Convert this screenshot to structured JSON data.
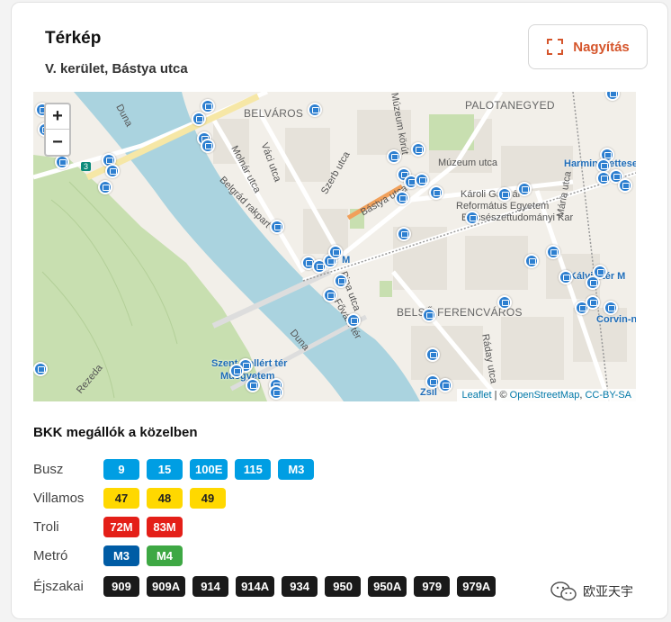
{
  "header": {
    "title": "Térkép",
    "subtitle": "V. kerület, Bástya utca",
    "zoom_button": "Nagyítás"
  },
  "map": {
    "labels": {
      "belvaros": "BELVÁROS",
      "palotanegyed": "PALOTANEGYED",
      "belso_ferencvaros": "BELSŐ FERENCVÁROS",
      "duna1": "Duna",
      "duna2": "Duna",
      "molnar": "Molnár utca",
      "vaci": "Váci utca",
      "belgrad": "Belgrád rakpart",
      "szerb": "Szerb utca",
      "bastya": "Bástya utca",
      "muzeum": "Múzeum utca",
      "karoli": "Károli Gáspár",
      "reformatus": "Református Egyetem",
      "bolcsesz": "Bölcsészettudományi Kar",
      "pipa": "Pipa utca",
      "fovam": "Fővám tér",
      "radai": "Ráday utca",
      "mana": "Mária utca",
      "kalvin": "Kálvin tér M",
      "harminckettesek": "Harminckettesek",
      "corvin": "Corvin-negyed M",
      "szent_gellert": "Szent Gellért tér",
      "muegyetem": "Műegyetem",
      "rezeda": "Rezeda",
      "zsil": "Zsil",
      "ter_m": "tér M",
      "muzeum_korut": "Múzeum körút",
      "dt": "3"
    },
    "zoom_in": "+",
    "zoom_out": "−",
    "attribution": {
      "leaflet": "Leaflet",
      "sep": "| ©",
      "osm": "OpenStreetMap",
      "comma": ",",
      "license": "CC-BY-SA"
    }
  },
  "stops": {
    "title": "BKK megállók a közelben",
    "rows": [
      {
        "label": "Busz",
        "kind": "bus",
        "lines": [
          "9",
          "15",
          "100E",
          "115",
          "M3"
        ]
      },
      {
        "label": "Villamos",
        "kind": "tram",
        "lines": [
          "47",
          "48",
          "49"
        ]
      },
      {
        "label": "Troli",
        "kind": "troli",
        "lines": [
          "72M",
          "83M"
        ]
      },
      {
        "label": "Metró",
        "kind": "metro",
        "lines": [
          "M3",
          "M4"
        ]
      },
      {
        "label": "Éjszakai",
        "kind": "night",
        "lines": [
          "909",
          "909A",
          "914",
          "914A",
          "934",
          "950",
          "950A",
          "979",
          "979A"
        ]
      }
    ]
  },
  "watermark": {
    "text": "欧亚天宇",
    "icon": "wechat-icon"
  },
  "colors": {
    "accent": "#d5552b",
    "bus": "#009ee3",
    "tram": "#ffd800",
    "troli": "#e41f18",
    "metro_m3": "#005ca5",
    "metro_m4": "#3ea844",
    "night": "#1a1a1a",
    "water": "#aad3df",
    "park": "#c8dfb0"
  }
}
